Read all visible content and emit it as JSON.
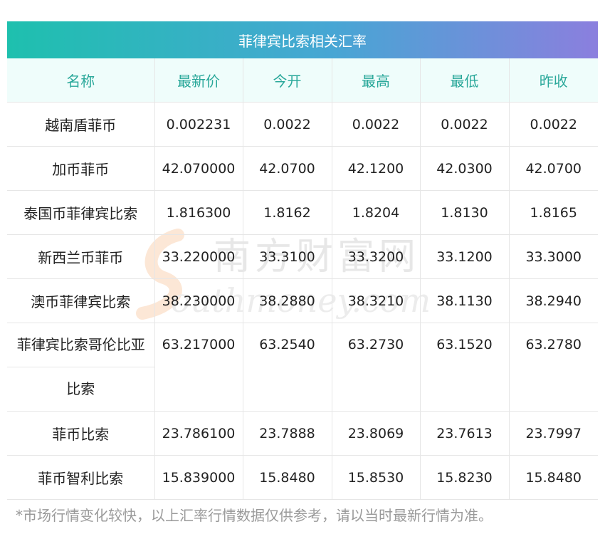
{
  "title": "菲律宾比索相关汇率",
  "headers": [
    "名称",
    "最新价",
    "今开",
    "最高",
    "最低",
    "昨收"
  ],
  "rows": [
    {
      "name": "越南盾菲币",
      "values": [
        "0.002231",
        "0.0022",
        "0.0022",
        "0.0022",
        "0.0022"
      ]
    },
    {
      "name": "加币菲币",
      "values": [
        "42.070000",
        "42.0700",
        "42.1200",
        "42.0300",
        "42.0700"
      ]
    },
    {
      "name": "泰国币菲律宾比索",
      "values": [
        "1.816300",
        "1.8162",
        "1.8204",
        "1.8130",
        "1.8165"
      ]
    },
    {
      "name": "新西兰币菲币",
      "values": [
        "33.220000",
        "33.3100",
        "33.3200",
        "33.1200",
        "33.3000"
      ]
    },
    {
      "name": "澳币菲律宾比索",
      "values": [
        "38.230000",
        "38.2880",
        "38.3210",
        "38.1130",
        "38.2940"
      ]
    },
    {
      "name": "菲律宾比索哥伦比亚比索",
      "values": [
        "63.217000",
        "63.2540",
        "63.2730",
        "63.1520",
        "63.2780"
      ]
    },
    {
      "name": "菲币比索",
      "values": [
        "23.786100",
        "23.7888",
        "23.8069",
        "23.7613",
        "23.7997"
      ]
    },
    {
      "name": "菲币智利比索",
      "values": [
        "15.839000",
        "15.8480",
        "15.8530",
        "15.8230",
        "15.8480"
      ]
    }
  ],
  "watermark": {
    "cn": "南方财富网",
    "en": "outhmoney.com"
  },
  "footnote": "*市场行情变化较快，以上汇率行情数据仅供参考，请以当时最新行情为准。"
}
